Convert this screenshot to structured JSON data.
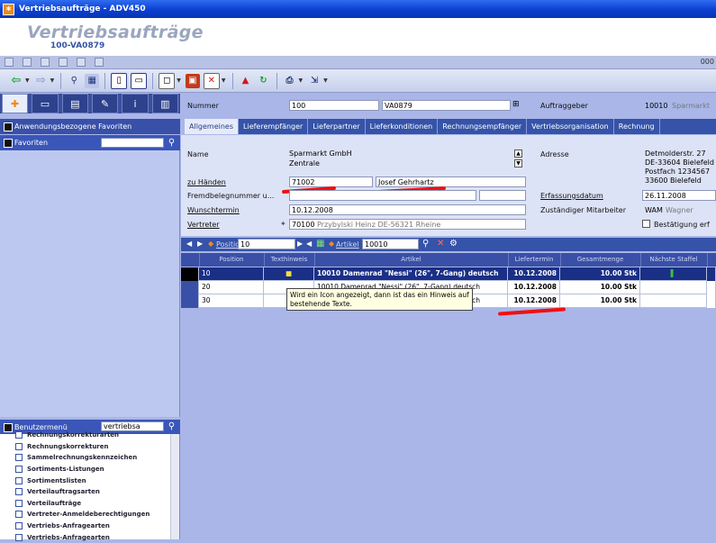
{
  "window": {
    "title": "Vertriebsaufträge - ADV450",
    "app_icon": "app-icon"
  },
  "header": {
    "title": "Vertriebsaufträge",
    "subtitle": "100-VA0879"
  },
  "strip": {
    "right_number": "000"
  },
  "left": {
    "tabs": [
      {
        "icon": "pin-icon"
      },
      {
        "icon": "monitor-icon"
      },
      {
        "icon": "screen-icon"
      },
      {
        "icon": "clipboard-icon"
      },
      {
        "icon": "info-icon"
      },
      {
        "icon": "book-icon"
      }
    ],
    "app_favorites_label": "Anwendungsbezogene Favoriten",
    "favorites_label": "Favoriten",
    "favorites_search": "",
    "usermenu_label": "Benutzermenü",
    "usermenu_search": "vertriebsa",
    "menu_items": [
      "Rechnungskorrekturarten",
      "Rechnungskorrekturen",
      "Sammelrechnungskennzeichen",
      "Sortiments-Listungen",
      "Sortimentslisten",
      "Verteilauftragsarten",
      "Verteilaufträge",
      "Vertreter-Anmeldeberechtigungen",
      "Vertriebs-Anfragearten",
      "Vertriebs-Anfragearten"
    ]
  },
  "form": {
    "nummer_label": "Nummer",
    "nummer_prefix": "100",
    "nummer_value": "VA0879",
    "auftraggeber_label": "Auftraggeber",
    "auftraggeber_value": "10010",
    "auftraggeber_name": "Sparmarkt",
    "tabs": [
      "Allgemeines",
      "Lieferempfänger",
      "Lieferpartner",
      "Lieferkonditionen",
      "Rechnungsempfänger",
      "Vertriebsorganisation",
      "Rechnung"
    ],
    "name_label": "Name",
    "name_line1": "Sparmarkt GmbH",
    "name_line2": "Zentrale",
    "adresse_label": "Adresse",
    "adresse_lines": [
      "Detmolderstr. 27",
      "DE-33604 Bielefeld",
      "Postfach 1234567",
      "33600 Bielefeld"
    ],
    "zu_haenden_label": "zu Händen",
    "zu_haenden_nr": "71002",
    "zu_haenden_name": "Josef Gehrhartz",
    "fremdbeleg_label": "Fremdbelegnummer u...",
    "erfassung_label": "Erfassungsdatum",
    "erfassung_value": "26.11.2008",
    "wunschtermin_label": "Wunschtermin",
    "wunschtermin_value": "10.12.2008",
    "mitarbeiter_label": "Zuständiger Mitarbeiter",
    "mitarbeiter_code": "WAM",
    "mitarbeiter_name": "Wagner",
    "vertreter_label": "Vertreter",
    "vertreter_value": "70100",
    "vertreter_name": "Przybylski Heinz DE-56321 Rheine",
    "bestaetigung_label": "Bestätigung erf"
  },
  "grid": {
    "position_label": "Position",
    "position_value": "10",
    "artikel_label": "Artikel",
    "artikel_value": "10010",
    "headers": [
      "Position",
      "Texthinweis",
      "Artikel",
      "Liefertermin",
      "Gesamtmenge",
      "Nächste Staffel"
    ],
    "rows": [
      {
        "position": "10",
        "artikel": "10010 Damenrad \"Nessi\" (26\", 7-Gang) deutsch",
        "termin": "10.12.2008",
        "menge": "10.00 Stk"
      },
      {
        "position": "20",
        "artikel": "10010 Damenrad \"Nessi\" (26\", 7-Gang) deutsch",
        "termin": "10.12.2008",
        "menge": "10.00 Stk"
      },
      {
        "position": "30",
        "artikel": "10010 Damenrad \"Nessi\" (26\", 7-Gang) deutsch",
        "termin": "10.12.2008",
        "menge": "10.00 Stk"
      }
    ],
    "tooltip": "Wird ein Icon angezeigt, dann ist das ein Hinweis auf bestehende Texte."
  },
  "colors": {
    "accent": "#3553a8",
    "annotation": "#f01010",
    "highlight": "#f08a1c"
  }
}
